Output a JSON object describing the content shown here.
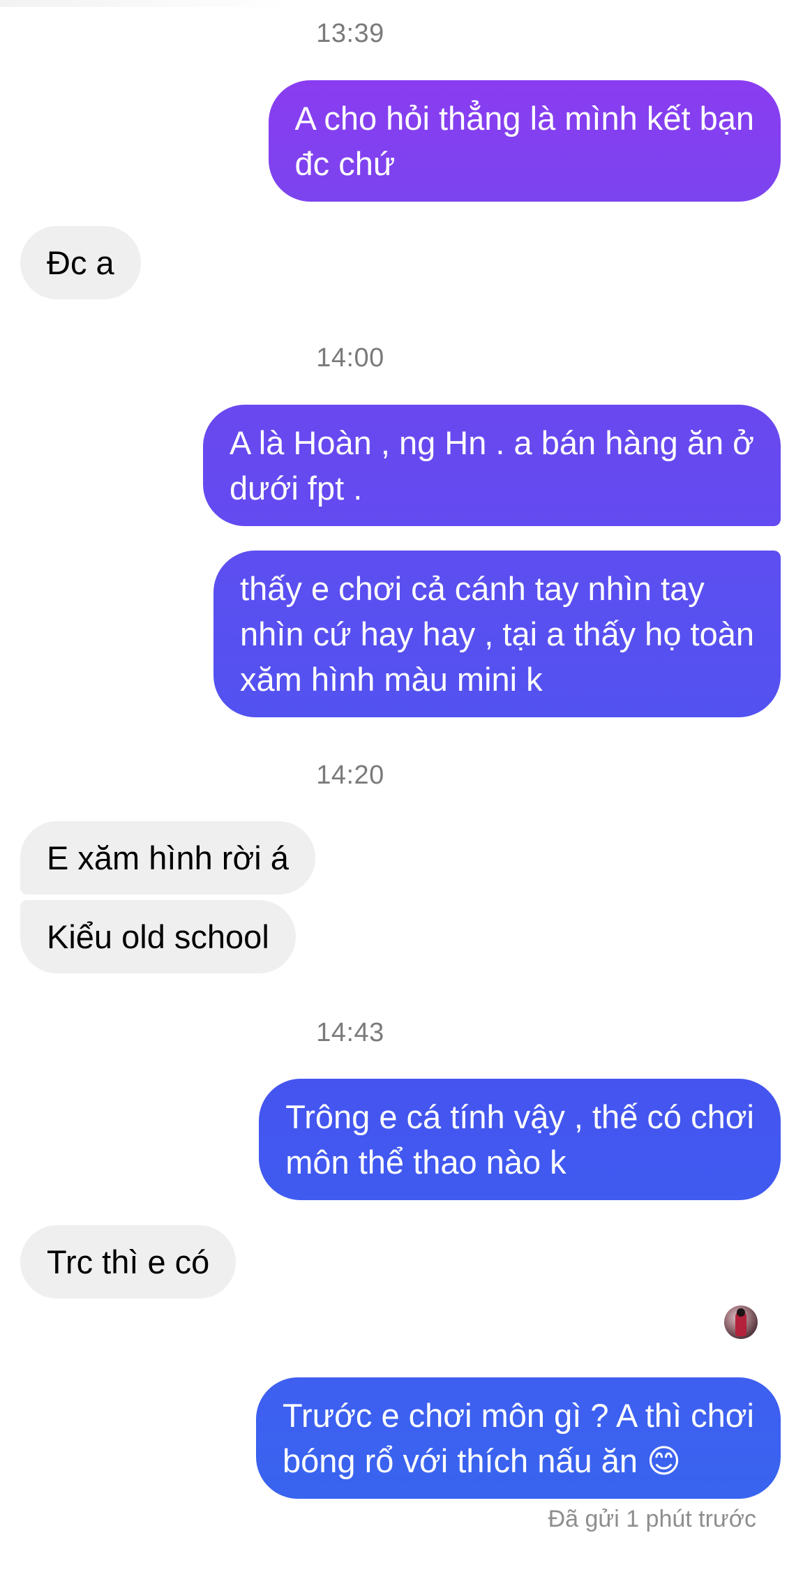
{
  "timestamps": [
    "13:39",
    "14:00",
    "14:20",
    "14:43"
  ],
  "messages": [
    {
      "lines": [
        "A cho hỏi thẳng là mình kết bạn",
        "đc chứ"
      ]
    },
    {
      "lines": [
        "Đc a"
      ]
    },
    {
      "lines": [
        "A là Hoàn , ng Hn . a bán hàng ăn ở",
        "dưới fpt ."
      ]
    },
    {
      "lines": [
        "thấy e chơi cả cánh tay nhìn tay",
        "nhìn cứ hay hay , tại a thấy họ toàn",
        "xăm hình màu mini k"
      ]
    },
    {
      "lines": [
        "E xăm hình rời á"
      ]
    },
    {
      "lines": [
        "Kiểu old school"
      ]
    },
    {
      "lines": [
        "Trông e cá tính vậy , thế có chơi",
        "môn thể thao nào k"
      ]
    },
    {
      "lines": [
        "Trc thì e có"
      ]
    },
    {
      "lines": [
        "Trước e chơi môn gì ? A thì chơi",
        "bóng rổ với thích nấu ăn 😊"
      ]
    }
  ],
  "status": {
    "sent": "Đã gửi 1 phút trước",
    "seen_avatar": "profile-avatar"
  },
  "colors": {
    "outgoing_purple": "#7c3aed",
    "outgoing_indigo": "#5b4af0",
    "outgoing_blue": "#3d5ef0",
    "incoming_bg": "#efefef",
    "timestamp": "#7a7a7a"
  }
}
